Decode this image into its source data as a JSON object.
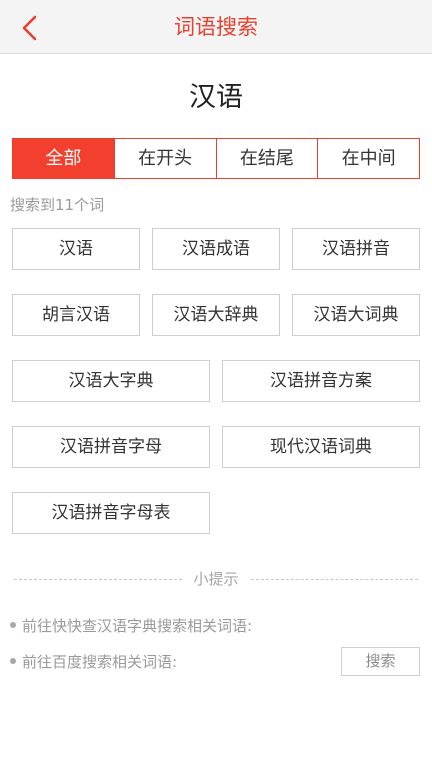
{
  "header": {
    "title": "词语搜索",
    "back_icon": "chevron-left-icon",
    "accent_color": "#e8402f"
  },
  "query": {
    "word": "汉语"
  },
  "tabs": [
    {
      "label": "全部",
      "active": true
    },
    {
      "label": "在开头",
      "active": false
    },
    {
      "label": "在结尾",
      "active": false
    },
    {
      "label": "在中间",
      "active": false
    }
  ],
  "results": {
    "count_text": "搜索到11个词",
    "words": [
      "汉语",
      "汉语成语",
      "汉语拼音",
      "胡言汉语",
      "汉语大辞典",
      "汉语大词典",
      "汉语大字典",
      "汉语拼音方案",
      "汉语拼音字母",
      "现代汉语词典",
      "汉语拼音字母表"
    ]
  },
  "tips": {
    "label": "小提示",
    "items": [
      {
        "text": "前往快快查汉语字典搜索相关词语:"
      },
      {
        "text": "前往百度搜索相关词语:"
      }
    ],
    "search_button": "搜索"
  }
}
